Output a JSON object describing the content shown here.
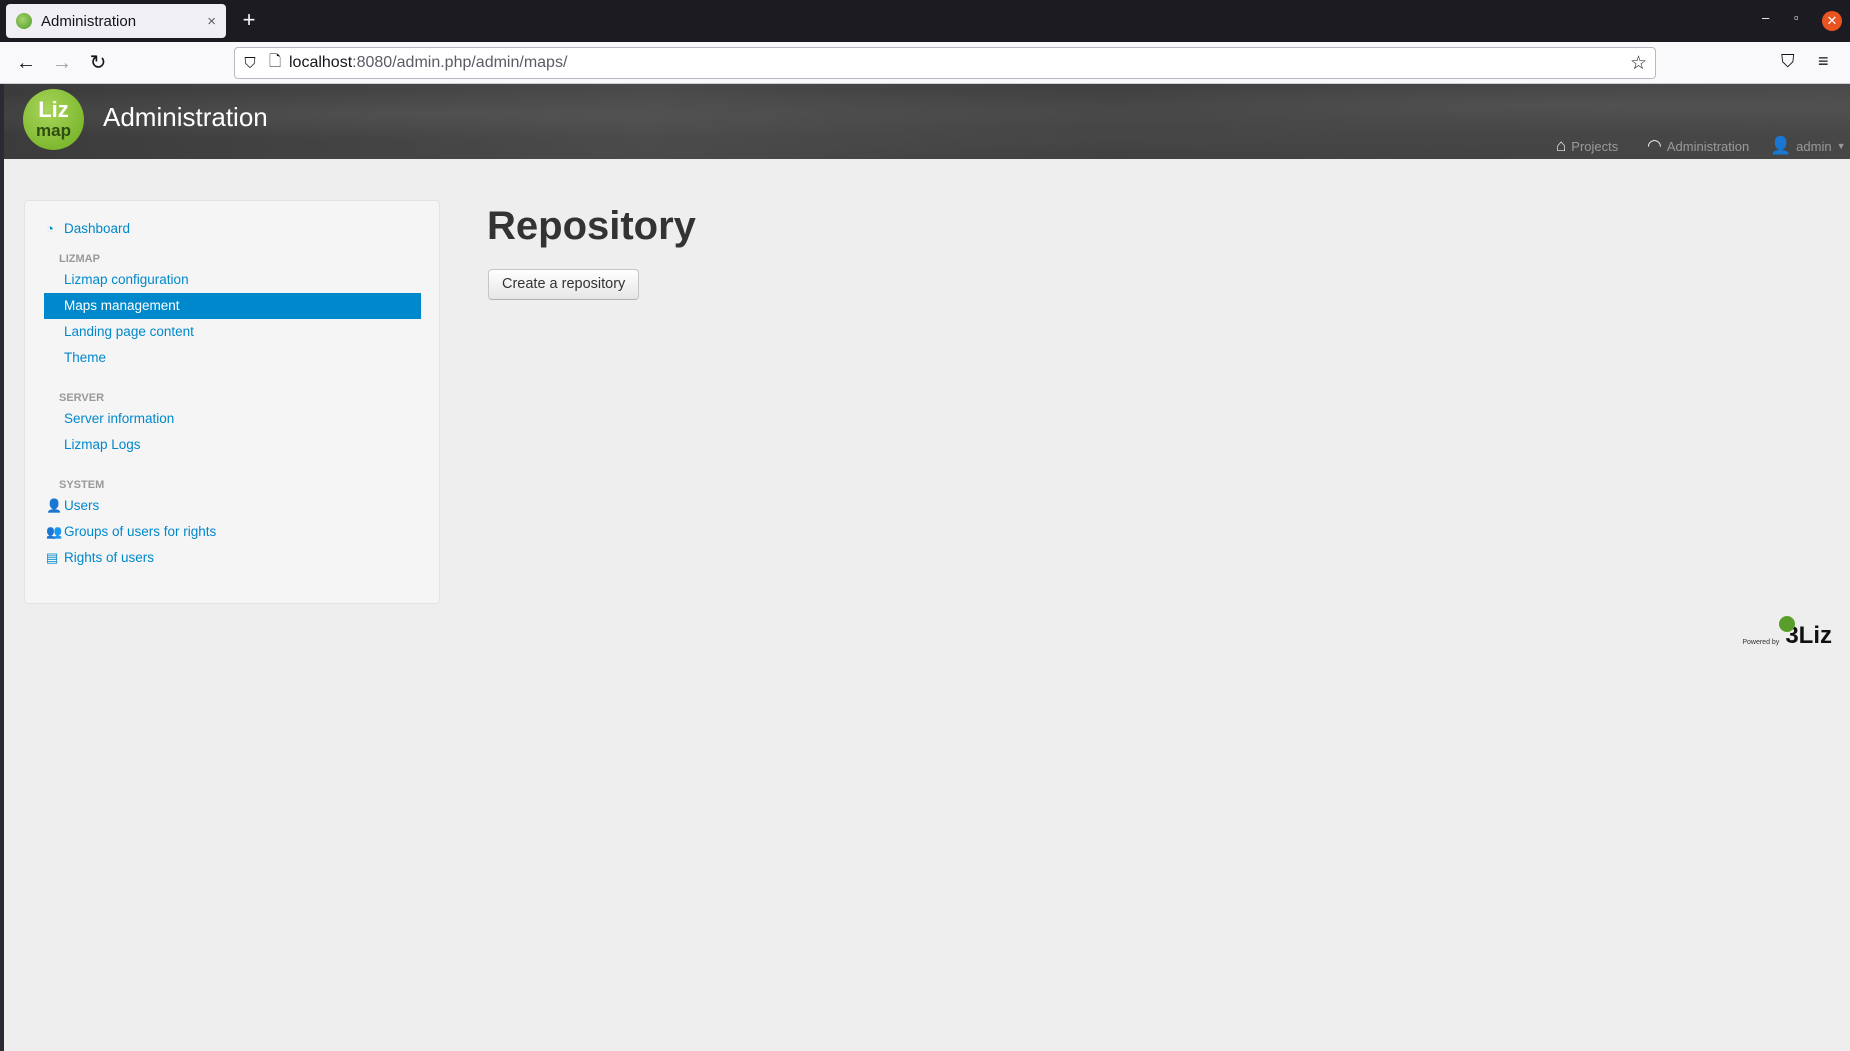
{
  "browser": {
    "tab_title": "Administration",
    "tab_close": "×",
    "new_tab": "+",
    "url_host": "localhost",
    "url_rest": ":8080/admin.php/admin/maps/",
    "win_minimize": "–",
    "win_restore": "▫",
    "win_close": "✕"
  },
  "header": {
    "logo_top": "Liz",
    "logo_bottom": "map",
    "title": "Administration",
    "nav": {
      "projects": "Projects",
      "administration": "Administration",
      "user": "admin"
    }
  },
  "sidebar": {
    "dashboard": "Dashboard",
    "sections": {
      "lizmap": "LIZMAP",
      "server": "SERVER",
      "system": "SYSTEM"
    },
    "lizmap_items": [
      "Lizmap configuration",
      "Maps management",
      "Landing page content",
      "Theme"
    ],
    "server_items": [
      "Server information",
      "Lizmap Logs"
    ],
    "system_items": [
      "Users",
      "Groups of users for rights",
      "Rights of users"
    ],
    "active_item": "Maps management"
  },
  "main": {
    "title": "Repository",
    "create_button": "Create a repository"
  },
  "footer": {
    "powered_by": "Powered by",
    "brand": "3Liz"
  },
  "colors": {
    "link": "#0088cc",
    "active_bg": "#0088cc",
    "page_bg": "#eeeeee",
    "logo_green": "#8cc63f"
  }
}
